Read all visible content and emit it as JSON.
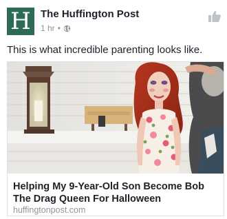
{
  "post": {
    "avatar_letter": "H",
    "page_name": "The Huffington Post",
    "time": "1 hr",
    "separator": "•",
    "privacy_icon": "globe-icon",
    "action_icon": "thumbs-up-icon",
    "status_text": "This is what incredible parenting looks like."
  },
  "link": {
    "title": "Helping My 9-Year-Old Son Become Bob The Drag Queen For Halloween",
    "domain": "huffingtonpost.com",
    "image_subject": "child-with-red-wig-and-floral-dress"
  },
  "colors": {
    "avatar_bg": "#2e6b55",
    "text_primary": "#1d2129",
    "text_secondary": "#90949c",
    "card_border": "#dddfe2"
  }
}
